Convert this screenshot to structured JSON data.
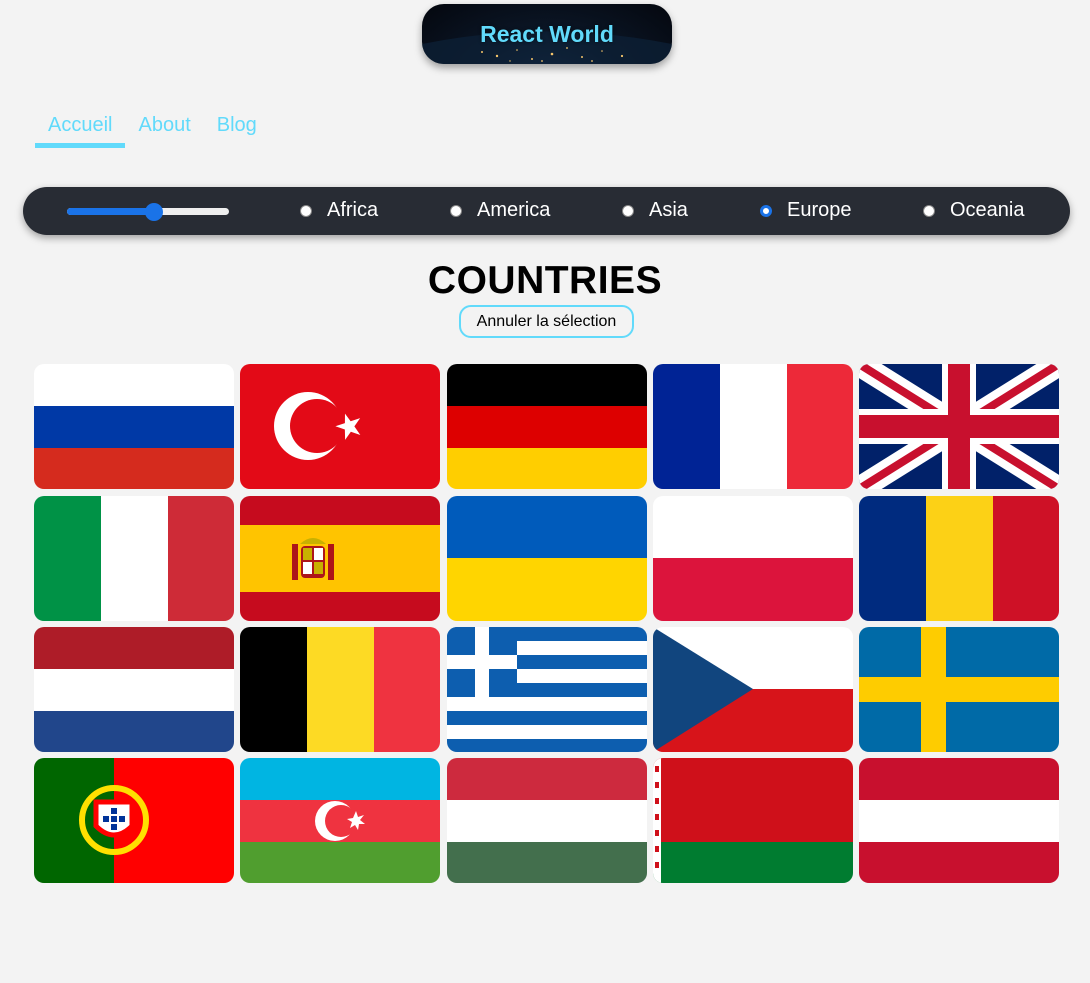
{
  "header": {
    "logo_text": "React World"
  },
  "nav": {
    "items": [
      "Accueil",
      "About",
      "Blog"
    ],
    "active": 0
  },
  "filters": {
    "slider": {
      "value_fraction": 0.5
    },
    "regions": [
      "Africa",
      "America",
      "Asia",
      "Europe",
      "Oceania"
    ],
    "selected": "Europe"
  },
  "main": {
    "title": "COUNTRIES",
    "cancel_label": "Annuler la sélection"
  },
  "flags": [
    "russia-flag",
    "turkey-flag",
    "germany-flag",
    "france-flag",
    "united-kingdom-flag",
    "italy-flag",
    "spain-flag",
    "ukraine-flag",
    "poland-flag",
    "romania-flag",
    "netherlands-flag",
    "belgium-flag",
    "greece-flag",
    "czechia-flag",
    "sweden-flag",
    "portugal-flag",
    "azerbaijan-flag",
    "hungary-flag",
    "belarus-flag",
    "austria-flag"
  ],
  "colors": {
    "accent": "#61dafb",
    "bar": "#282c34",
    "slider": "#1a73e8"
  }
}
